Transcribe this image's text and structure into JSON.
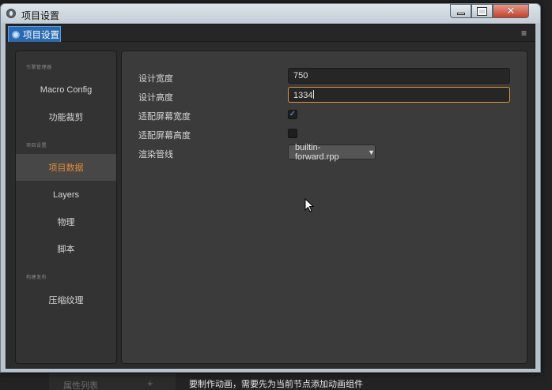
{
  "window": {
    "title": "项目设置"
  },
  "tab": {
    "label": "项目设置"
  },
  "sidebar": {
    "groups": [
      "引擎管理器",
      "项目设置",
      "构建发布"
    ],
    "items": [
      {
        "label": "Macro Config"
      },
      {
        "label": "功能裁剪"
      },
      {
        "label": "项目数据",
        "active": true
      },
      {
        "label": "Layers"
      },
      {
        "label": "物理"
      },
      {
        "label": "脚本"
      },
      {
        "label": "压缩纹理"
      }
    ]
  },
  "form": {
    "design_width": {
      "label": "设计宽度",
      "value": "750"
    },
    "design_height": {
      "label": "设计高度",
      "value": "1334"
    },
    "fit_width": {
      "label": "适配屏幕宽度",
      "checked": true
    },
    "fit_height": {
      "label": "适配屏幕高度",
      "checked": false
    },
    "render_pipeline": {
      "label": "渲染管线",
      "value": "builtin-forward.rpp"
    }
  },
  "background": {
    "panel_label": "属性列表",
    "status_message": "要制作动画，需要先为当前节点添加动画组件"
  },
  "colors": {
    "accent": "#e68a2e",
    "tab_active": "#2a6ab3",
    "checkbox_check": "#6aa7ea"
  }
}
